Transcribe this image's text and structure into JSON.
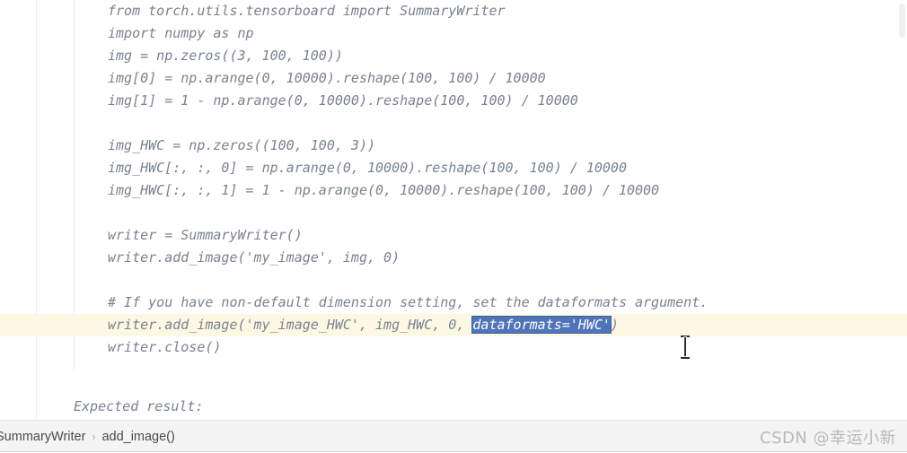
{
  "document": {
    "code_block": {
      "language_style": "python",
      "lines": [
        {
          "text": "from torch.utils.tensorboard import SummaryWriter",
          "highlighted": false
        },
        {
          "text": "import numpy as np",
          "highlighted": false
        },
        {
          "text": "img = np.zeros((3, 100, 100))",
          "highlighted": false
        },
        {
          "text": "img[0] = np.arange(0, 10000).reshape(100, 100) / 10000",
          "highlighted": false
        },
        {
          "text": "img[1] = 1 - np.arange(0, 10000).reshape(100, 100) / 10000",
          "highlighted": false
        },
        {
          "text": "",
          "highlighted": false
        },
        {
          "text": "img_HWC = np.zeros((100, 100, 3))",
          "highlighted": false
        },
        {
          "text": "img_HWC[:, :, 0] = np.arange(0, 10000).reshape(100, 100) / 10000",
          "highlighted": false
        },
        {
          "text": "img_HWC[:, :, 1] = 1 - np.arange(0, 10000).reshape(100, 100) / 10000",
          "highlighted": false
        },
        {
          "text": "",
          "highlighted": false
        },
        {
          "text": "writer = SummaryWriter()",
          "highlighted": false
        },
        {
          "text": "writer.add_image('my_image', img, 0)",
          "highlighted": false
        },
        {
          "text": "",
          "highlighted": false
        },
        {
          "text": "# If you have non-default dimension setting, set the dataformats argument.",
          "highlighted": false
        },
        {
          "text": "writer.add_image('my_image_HWC', img_HWC, 0, dataformats='HWC')",
          "highlighted": true,
          "selection": {
            "prefix": "writer.add_image('my_image_HWC', img_HWC, 0, ",
            "selected": "dataformats='HWC'",
            "suffix": ")"
          }
        },
        {
          "text": "writer.close()",
          "highlighted": false
        }
      ]
    },
    "expected_result_label": "Expected result:"
  },
  "status_bar": {
    "breadcrumb": [
      {
        "label": "SummaryWriter"
      },
      {
        "label": "add_image()"
      }
    ],
    "separator": "›",
    "watermark": "CSDN @幸运小新"
  },
  "colors": {
    "code_text": "#79828f",
    "selection_background": "#4f74b8",
    "selection_text": "#ffffff",
    "line_highlight": "#fdf8e3",
    "status_bar_background": "#f4f4f4",
    "watermark_text": "#b9b9b9"
  }
}
